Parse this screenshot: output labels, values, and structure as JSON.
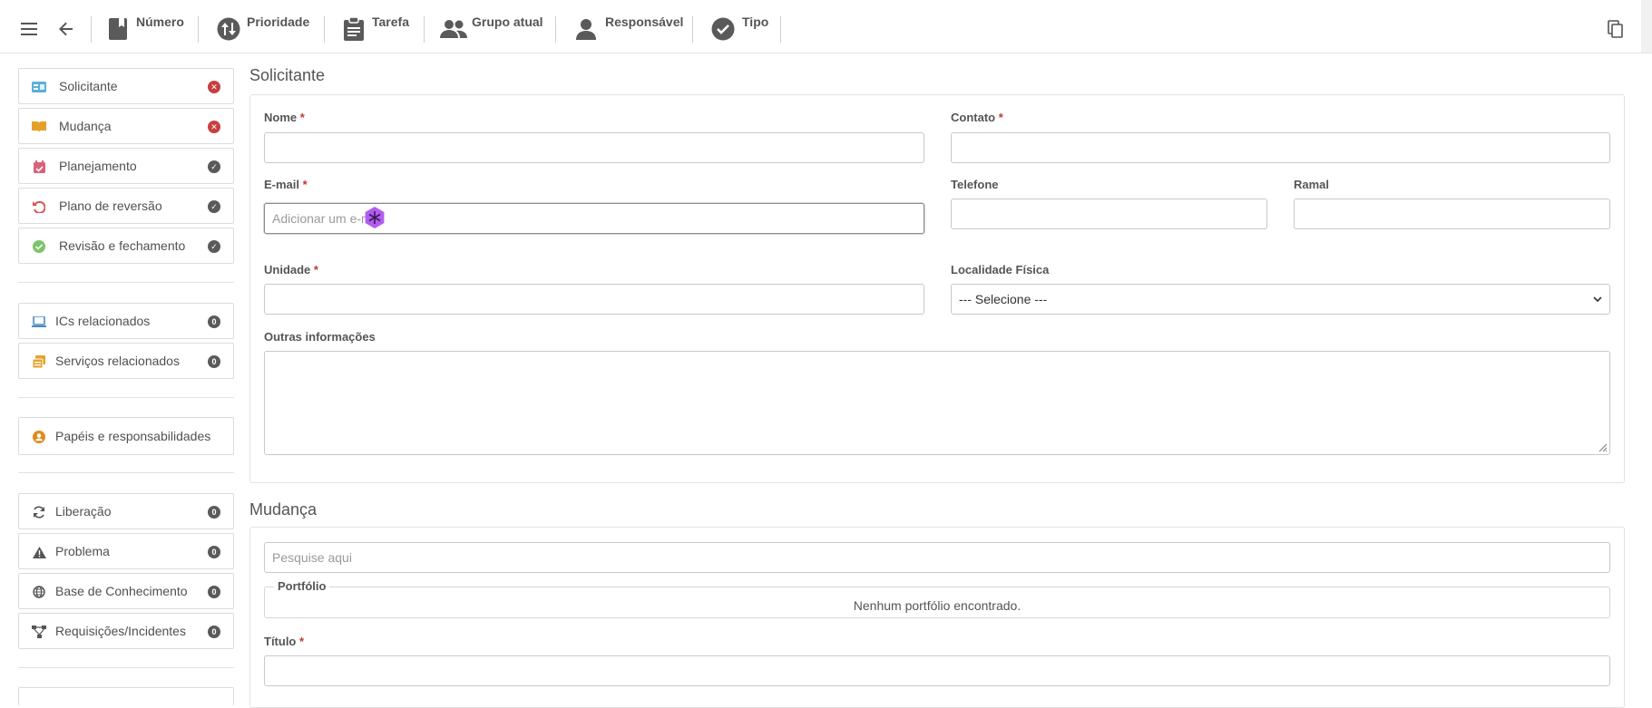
{
  "toolbar": {
    "items": [
      {
        "label": "Número",
        "icon": "bookmark-icon"
      },
      {
        "label": "Prioridade",
        "icon": "priority-arrows-icon"
      },
      {
        "label": "Tarefa",
        "icon": "clipboard-icon"
      },
      {
        "label": "Grupo atual",
        "icon": "group-icon"
      },
      {
        "label": "Responsável",
        "icon": "person-icon"
      },
      {
        "label": "Tipo",
        "icon": "check-circle-icon"
      }
    ]
  },
  "sidebar": {
    "group1": [
      {
        "label": "Solicitante",
        "status": "error",
        "icon": "id-card-icon",
        "icon_color": "#5ab0d6"
      },
      {
        "label": "Mudança",
        "status": "error",
        "icon": "book-open-icon",
        "icon_color": "#e6a02a"
      },
      {
        "label": "Planejamento",
        "status": "ok",
        "icon": "calendar-check-icon",
        "icon_color": "#d9627a"
      },
      {
        "label": "Plano de reversão",
        "status": "ok",
        "icon": "undo-icon",
        "icon_color": "#d9534f"
      },
      {
        "label": "Revisão e fechamento",
        "status": "ok",
        "icon": "check-circle-icon",
        "icon_color": "#7cc46a"
      }
    ],
    "group2": [
      {
        "label": "ICs relacionados",
        "count": "0",
        "icon": "laptop-icon",
        "icon_color": "#4a8ac4"
      },
      {
        "label": "Serviços relacionados",
        "count": "0",
        "icon": "services-icon",
        "icon_color": "#e6a02a"
      }
    ],
    "group3": [
      {
        "label": "Papéis e responsabilidades",
        "icon": "user-circle-icon",
        "icon_color": "#e08a1e"
      }
    ],
    "group4": [
      {
        "label": "Liberação",
        "count": "0",
        "icon": "sync-icon",
        "icon_color": "#555555"
      },
      {
        "label": "Problema",
        "count": "0",
        "icon": "warning-icon",
        "icon_color": "#555555"
      },
      {
        "label": "Base de Conhecimento",
        "count": "0",
        "icon": "globe-icon",
        "icon_color": "#555555"
      },
      {
        "label": "Requisições/Incidentes",
        "count": "0",
        "icon": "sitemap-icon",
        "icon_color": "#555555"
      }
    ]
  },
  "solicitante": {
    "title": "Solicitante",
    "nome_label": "Nome",
    "contato_label": "Contato",
    "email_label": "E-mail",
    "email_placeholder": "Adicionar um e-m",
    "telefone_label": "Telefone",
    "ramal_label": "Ramal",
    "unidade_label": "Unidade",
    "localidade_label": "Localidade Física",
    "localidade_value": "--- Selecione ---",
    "outras_label": "Outras informações",
    "required_mark": "*"
  },
  "mudanca": {
    "title": "Mudança",
    "search_placeholder": "Pesquise aqui",
    "portfolio_legend": "Portfólio",
    "portfolio_empty": "Nenhum portfólio encontrado.",
    "titulo_label": "Título"
  },
  "colors": {
    "required": "#c0392b",
    "badge_error": "#c63f3f",
    "badge_ok": "#5a5a5a",
    "cursor_purple": "#b25cf0"
  }
}
